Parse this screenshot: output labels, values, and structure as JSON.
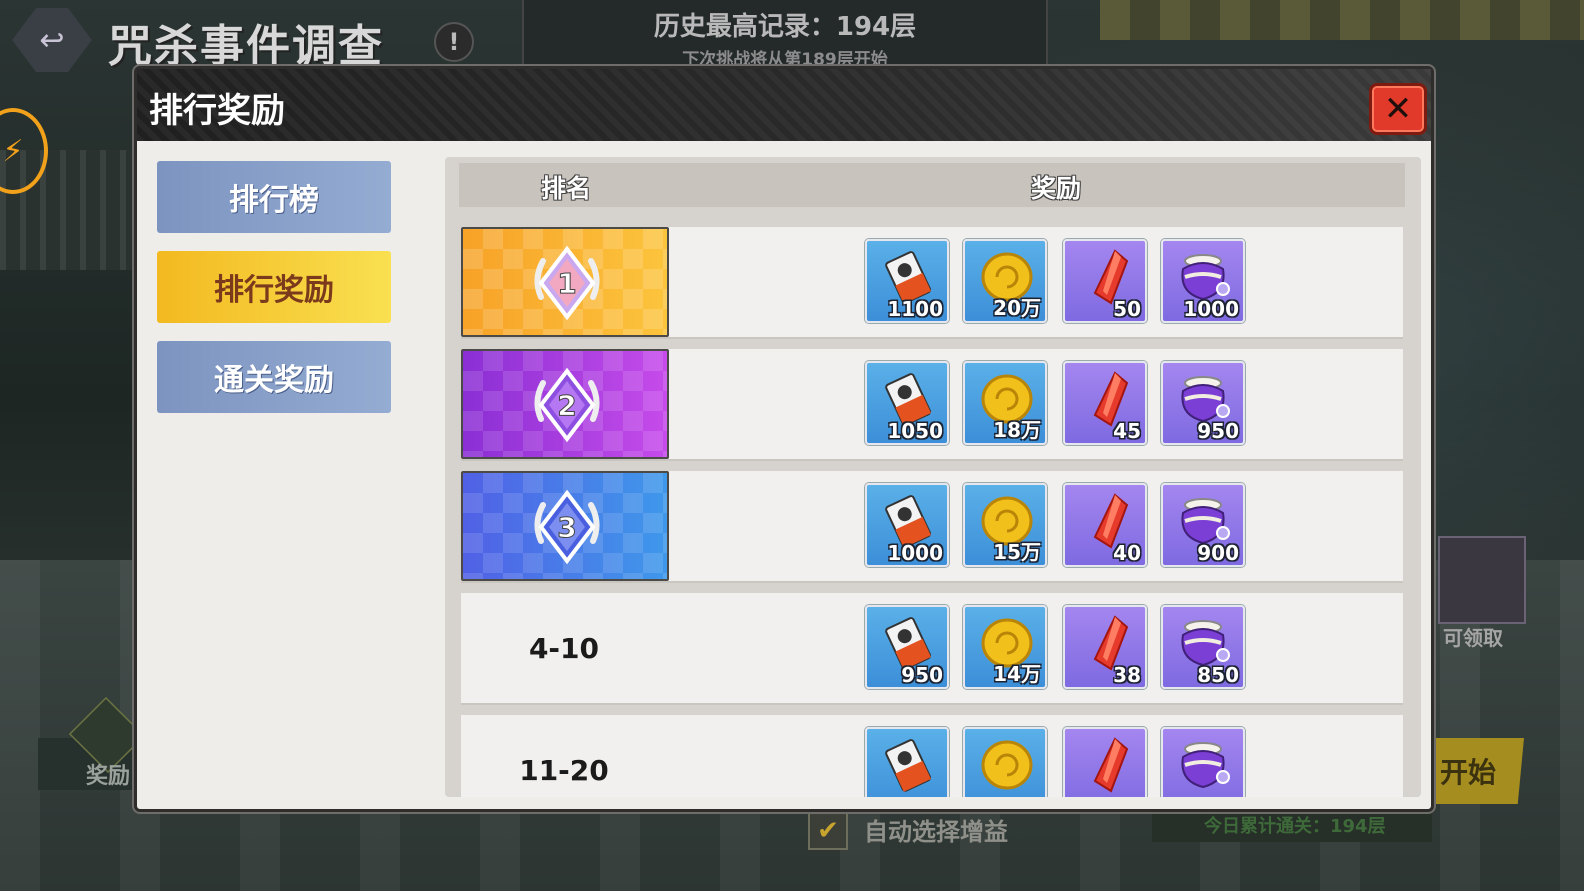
{
  "background": {
    "page_title": "咒杀事件调查",
    "record_title": "历史最高记录：194层",
    "record_sub": "下次挑战将从第189层开始",
    "left_reward_label": "奖励",
    "claimable_label": "可领取",
    "start_label": "开始",
    "auto_select_label": "自动选择增益",
    "today_label": "今日累计通关：194层"
  },
  "modal": {
    "title": "排行奖励",
    "close_label": "✕",
    "tabs": [
      {
        "label": "排行榜",
        "active": false
      },
      {
        "label": "排行奖励",
        "active": true
      },
      {
        "label": "通关奖励",
        "active": false
      }
    ],
    "table": {
      "headers": [
        "排名",
        "奖励"
      ],
      "rows": [
        {
          "rank": "1",
          "style": "gold",
          "rewards": [
            "1100",
            "20万",
            "50",
            "1000"
          ]
        },
        {
          "rank": "2",
          "style": "purple",
          "rewards": [
            "1050",
            "18万",
            "45",
            "950"
          ]
        },
        {
          "rank": "3",
          "style": "blue",
          "rewards": [
            "1000",
            "15万",
            "40",
            "900"
          ]
        },
        {
          "rank": "4-10",
          "style": "plain",
          "rewards": [
            "950",
            "14万",
            "38",
            "850"
          ]
        },
        {
          "rank": "11-20",
          "style": "plain",
          "rewards": [
            "",
            "",
            "",
            ""
          ]
        }
      ]
    },
    "reward_icons": [
      "ticket-card-icon",
      "gold-coin-icon",
      "red-crystal-icon",
      "purple-pot-icon"
    ]
  }
}
